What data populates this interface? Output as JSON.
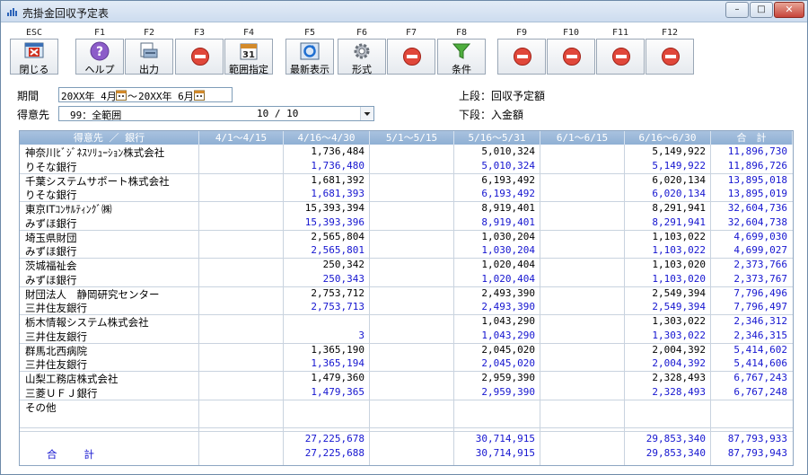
{
  "window": {
    "title": "売掛金回収予定表",
    "min": "–",
    "max": "□",
    "close": "✕"
  },
  "toolbar": [
    {
      "key": "ESC",
      "label": "閉じる",
      "icon": "close-window-icon"
    },
    {
      "key": "F1",
      "label": "ヘルプ",
      "icon": "help-icon"
    },
    {
      "key": "F2",
      "label": "出力",
      "icon": "output-icon"
    },
    {
      "key": "F3",
      "label": "",
      "icon": "disabled-icon"
    },
    {
      "key": "F4",
      "label": "範囲指定",
      "icon": "calendar-icon"
    },
    {
      "key": "F5",
      "label": "最新表示",
      "icon": "refresh-icon"
    },
    {
      "key": "F6",
      "label": "形式",
      "icon": "gear-icon"
    },
    {
      "key": "F7",
      "label": "",
      "icon": "disabled-icon"
    },
    {
      "key": "F8",
      "label": "条件",
      "icon": "filter-icon"
    },
    {
      "key": "F9",
      "label": "",
      "icon": "disabled-icon"
    },
    {
      "key": "F10",
      "label": "",
      "icon": "disabled-icon"
    },
    {
      "key": "F11",
      "label": "",
      "icon": "disabled-icon"
    },
    {
      "key": "F12",
      "label": "",
      "icon": "disabled-icon"
    }
  ],
  "filters": {
    "period_label": "期間",
    "period_from": "20XX年 4月",
    "period_sep": "～",
    "period_to": "20XX年 6月",
    "customer_label": "得意先",
    "customer_value": "99：全範囲",
    "customer_count": "10 / 10",
    "legend_upper": "上段：回収予定額",
    "legend_lower": "下段：入金額"
  },
  "table": {
    "headers": [
      "得意先 ／ 銀行",
      "4/1～4/15",
      "4/16～4/30",
      "5/1～5/15",
      "5/16～5/31",
      "6/1～6/15",
      "6/16～6/30",
      "合　計"
    ],
    "rows": [
      {
        "customer": "神奈川ﾋﾞｼﾞﾈｽｿﾘｭｰｼｮﾝ株式会社",
        "bank": "りそな銀行",
        "plan": [
          "",
          "1,736,484",
          "",
          "5,010,324",
          "",
          "5,149,922",
          "11,896,730"
        ],
        "paid": [
          "",
          "1,736,480",
          "",
          "5,010,324",
          "",
          "5,149,922",
          "11,896,726"
        ]
      },
      {
        "customer": "千葉システムサポート株式会社",
        "bank": "りそな銀行",
        "plan": [
          "",
          "1,681,392",
          "",
          "6,193,492",
          "",
          "6,020,134",
          "13,895,018"
        ],
        "paid": [
          "",
          "1,681,393",
          "",
          "6,193,492",
          "",
          "6,020,134",
          "13,895,019"
        ]
      },
      {
        "customer": "東京ITｺﾝｻﾙﾃｨﾝｸﾞ㈱",
        "bank": "みずほ銀行",
        "plan": [
          "",
          "15,393,394",
          "",
          "8,919,401",
          "",
          "8,291,941",
          "32,604,736"
        ],
        "paid": [
          "",
          "15,393,396",
          "",
          "8,919,401",
          "",
          "8,291,941",
          "32,604,738"
        ]
      },
      {
        "customer": "埼玉県財団",
        "bank": "みずほ銀行",
        "plan": [
          "",
          "2,565,804",
          "",
          "1,030,204",
          "",
          "1,103,022",
          "4,699,030"
        ],
        "paid": [
          "",
          "2,565,801",
          "",
          "1,030,204",
          "",
          "1,103,022",
          "4,699,027"
        ]
      },
      {
        "customer": "茨城福祉会",
        "bank": "みずほ銀行",
        "plan": [
          "",
          "250,342",
          "",
          "1,020,404",
          "",
          "1,103,020",
          "2,373,766"
        ],
        "paid": [
          "",
          "250,343",
          "",
          "1,020,404",
          "",
          "1,103,020",
          "2,373,767"
        ]
      },
      {
        "customer": "財団法人　静岡研究センター",
        "bank": "三井住友銀行",
        "plan": [
          "",
          "2,753,712",
          "",
          "2,493,390",
          "",
          "2,549,394",
          "7,796,496"
        ],
        "paid": [
          "",
          "2,753,713",
          "",
          "2,493,390",
          "",
          "2,549,394",
          "7,796,497"
        ]
      },
      {
        "customer": "栃木情報システム株式会社",
        "bank": "三井住友銀行",
        "plan": [
          "",
          "",
          "",
          "1,043,290",
          "",
          "1,303,022",
          "2,346,312"
        ],
        "paid": [
          "",
          "3",
          "",
          "1,043,290",
          "",
          "1,303,022",
          "2,346,315"
        ]
      },
      {
        "customer": "群馬北西病院",
        "bank": "三井住友銀行",
        "plan": [
          "",
          "1,365,190",
          "",
          "2,045,020",
          "",
          "2,004,392",
          "5,414,602"
        ],
        "paid": [
          "",
          "1,365,194",
          "",
          "2,045,020",
          "",
          "2,004,392",
          "5,414,606"
        ]
      },
      {
        "customer": "山梨工務店株式会社",
        "bank": "三菱ＵＦＪ銀行",
        "plan": [
          "",
          "1,479,360",
          "",
          "2,959,390",
          "",
          "2,328,493",
          "6,767,243"
        ],
        "paid": [
          "",
          "1,479,365",
          "",
          "2,959,390",
          "",
          "2,328,493",
          "6,767,248"
        ]
      },
      {
        "customer": "その他",
        "bank": "",
        "plan": [
          "",
          "",
          "",
          "",
          "",
          "",
          ""
        ],
        "paid": [
          "",
          "",
          "",
          "",
          "",
          "",
          ""
        ]
      }
    ],
    "total": {
      "label": "合計",
      "plan": [
        "",
        "27,225,678",
        "",
        "30,714,915",
        "",
        "29,853,340",
        "87,793,933"
      ],
      "paid": [
        "",
        "27,225,688",
        "",
        "30,714,915",
        "",
        "29,853,340",
        "87,793,943"
      ]
    }
  }
}
